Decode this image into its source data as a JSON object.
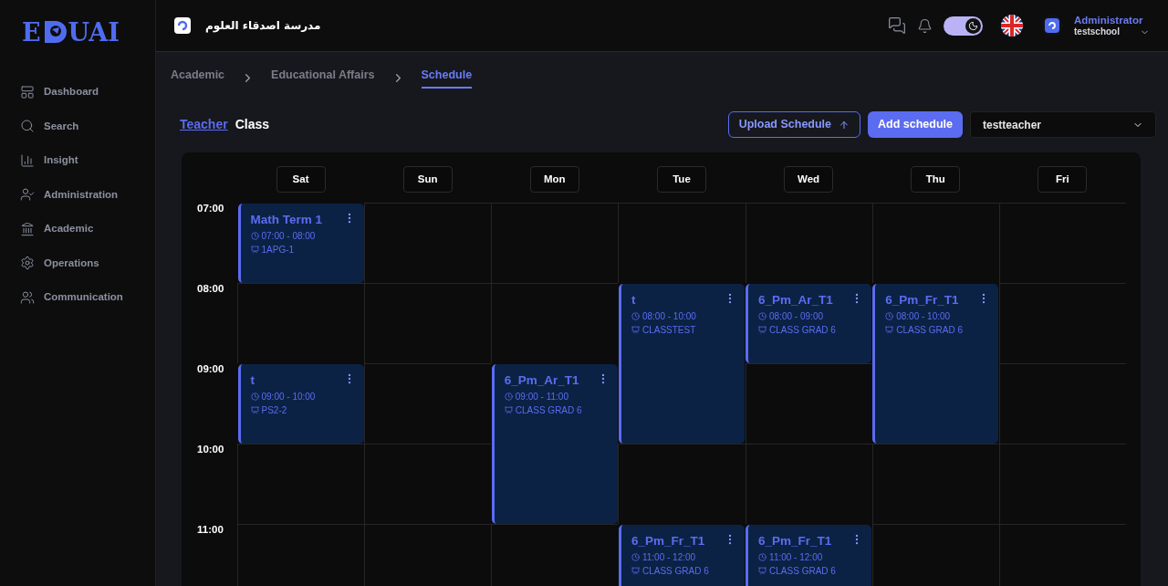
{
  "logo": {
    "before": "E",
    "after": "UAI"
  },
  "sidebar": {
    "items": [
      {
        "label": "Dashboard"
      },
      {
        "label": "Search"
      },
      {
        "label": "Insight"
      },
      {
        "label": "Administration"
      },
      {
        "label": "Academic"
      },
      {
        "label": "Operations"
      },
      {
        "label": "Communication"
      }
    ]
  },
  "header": {
    "school_name": "مدرسة اصدقاء العلوم",
    "dark_mode": true,
    "user": {
      "role": "Administrator",
      "school": "testschool"
    }
  },
  "breadcrumb": [
    {
      "label": "Academic",
      "selected": false
    },
    {
      "label": "Educational Affairs",
      "selected": false
    },
    {
      "label": "Schedule",
      "selected": true
    }
  ],
  "view_tabs": [
    {
      "label": "Teacher",
      "selected": true
    },
    {
      "label": "Class",
      "selected": false
    }
  ],
  "actions": {
    "upload": "Upload Schedule",
    "add": "Add schedule",
    "teacher_select": "testteacher"
  },
  "calendar": {
    "hours": [
      "07:00",
      "08:00",
      "09:00",
      "10:00",
      "11:00"
    ],
    "days": [
      {
        "label": "Sat",
        "events": [
          {
            "title": "Math Term 1",
            "time": "07:00 - 08:00",
            "room": "1APG-1"
          },
          {
            "title": "t",
            "time": "09:00 - 10:00",
            "room": "PS2-2"
          }
        ]
      },
      {
        "label": "Sun"
      },
      {
        "label": "Mon",
        "events": [
          {
            "title": "6_Pm_Ar_T1",
            "time": "09:00 - 11:00",
            "room": "CLASS GRAD 6"
          }
        ]
      },
      {
        "label": "Tue",
        "events": [
          {
            "title": "t",
            "time": "08:00 - 10:00",
            "room": "CLASSTEST"
          },
          {
            "title": "6_Pm_Fr_T1",
            "time": "11:00 - 12:00",
            "room": "CLASS GRAD 6"
          }
        ]
      },
      {
        "label": "Wed",
        "events": [
          {
            "title": "6_Pm_Ar_T1",
            "time": "08:00 - 09:00",
            "room": "CLASS GRAD 6"
          },
          {
            "title": "6_Pm_Fr_T1",
            "time": "11:00 - 12:00",
            "room": "CLASS GRAD 6"
          }
        ]
      },
      {
        "label": "Thu",
        "events": [
          {
            "title": "6_Pm_Fr_T1",
            "time": "08:00 - 10:00",
            "room": "CLASS GRAD 6"
          }
        ]
      },
      {
        "label": "Fri"
      }
    ]
  }
}
